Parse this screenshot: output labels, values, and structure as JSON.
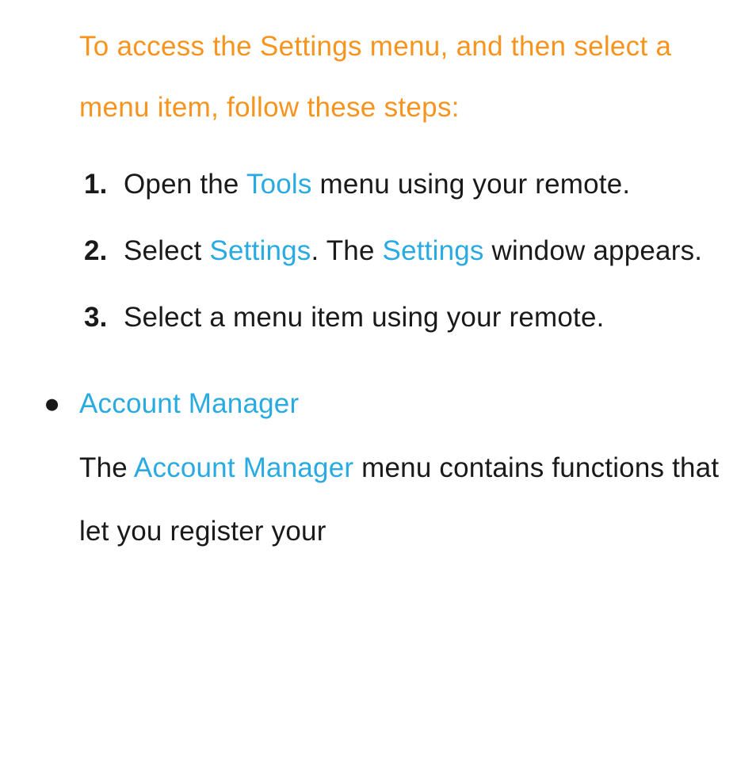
{
  "intro": "To access the Settings menu, and then select a menu item, follow these steps:",
  "steps": [
    {
      "number": "1.",
      "text_before": "Open the ",
      "keyword1": "Tools",
      "text_mid": " menu using your remote.",
      "keyword2": "",
      "text_after": ""
    },
    {
      "number": "2.",
      "text_before": "Select ",
      "keyword1": "Settings",
      "text_mid": ". The ",
      "keyword2": "Settings",
      "text_after": " window appears."
    },
    {
      "number": "3.",
      "text_before": "Select a menu item using your remote.",
      "keyword1": "",
      "text_mid": "",
      "keyword2": "",
      "text_after": ""
    }
  ],
  "bullet": {
    "marker": "●",
    "title": "Account Manager",
    "body_before": "The ",
    "body_keyword": "Account Manager",
    "body_after": " menu contains functions that let you register your"
  }
}
